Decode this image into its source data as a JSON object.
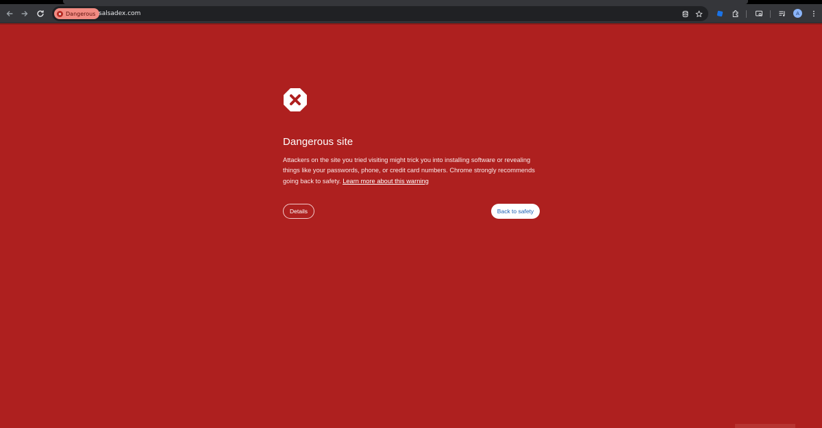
{
  "browser": {
    "security_chip": "Dangerous",
    "url": "salsadex.com",
    "avatar_initial": "A"
  },
  "icons": {
    "back": "arrow-left-icon",
    "forward": "arrow-right-icon",
    "reload": "reload-icon",
    "danger_chip": "x-circle-icon",
    "site_data": "database-icon",
    "bookmark": "star-icon",
    "extension_blue": "shield-extension-icon",
    "extensions": "puzzle-icon",
    "lens": "search-screen-icon",
    "media": "media-control-icon",
    "warning": "stop-x-icon"
  },
  "colors": {
    "page_background": "#ae201f",
    "chip_background": "#f28b82",
    "primary_button_text": "#1a5fb4"
  },
  "interstitial": {
    "title": "Dangerous site",
    "body": "Attackers on the site you tried visiting might trick you into installing software or revealing things like your passwords, phone, or credit card numbers. Chrome strongly recommends going back to safety.",
    "learn_more": "Learn more about this warning",
    "details_button": "Details",
    "back_button": "Back to safety"
  }
}
